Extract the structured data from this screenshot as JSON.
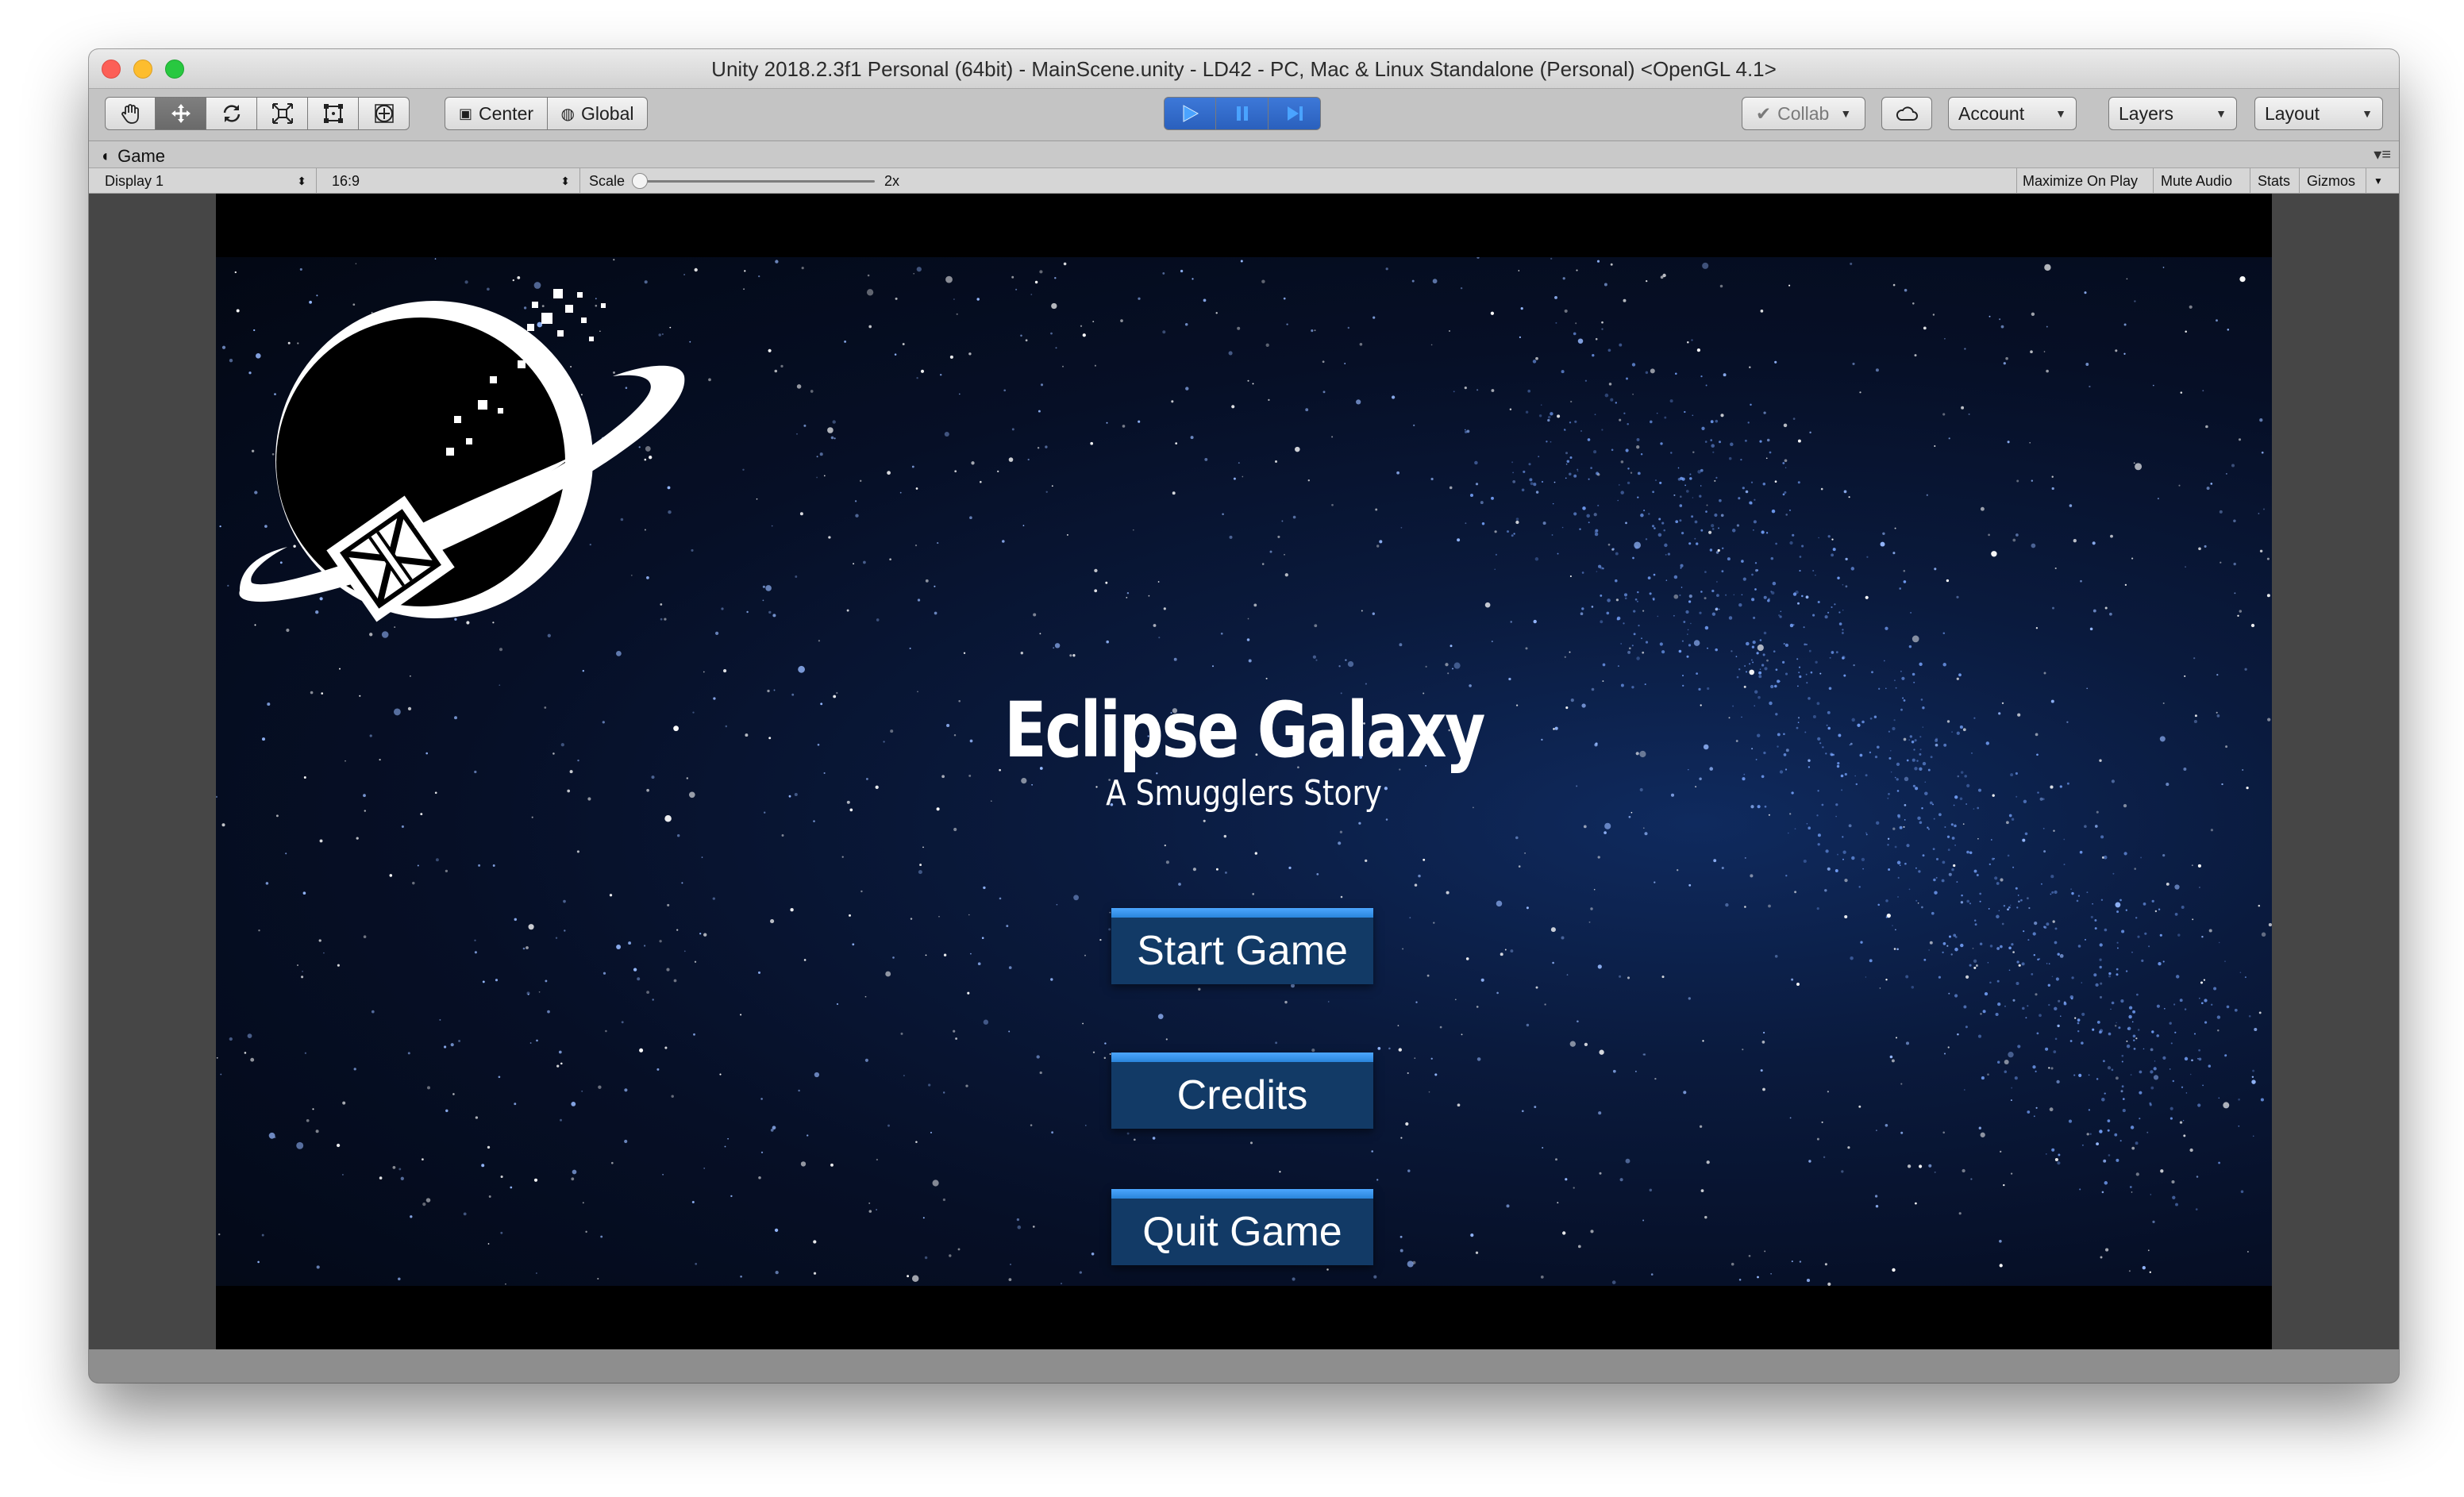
{
  "window": {
    "title": "Unity 2018.2.3f1 Personal (64bit) - MainScene.unity - LD42 - PC, Mac & Linux Standalone (Personal) <OpenGL 4.1>"
  },
  "toolbar": {
    "tools": [
      "hand-icon",
      "move-icon",
      "rotate-icon",
      "scale-icon",
      "rect-icon",
      "transform-icon"
    ],
    "pivot_center": "Center",
    "pivot_global": "Global",
    "collab": "Collab",
    "account": "Account",
    "layers": "Layers",
    "layout": "Layout",
    "play_color": "#2a60bd"
  },
  "game_panel": {
    "tab_label": "Game",
    "display": "Display 1",
    "aspect": "16:9",
    "scale_label": "Scale",
    "scale_value": "2x",
    "maximize_on_play": "Maximize On Play",
    "mute_audio": "Mute Audio",
    "stats": "Stats",
    "gizmos": "Gizmos"
  },
  "game": {
    "title": "Eclipse Galaxy",
    "subtitle": "A Smugglers Story",
    "buttons": {
      "start": "Start Game",
      "credits": "Credits",
      "quit": "Quit Game"
    },
    "button_color": "#123a66",
    "button_top_color": "#2a8ae0"
  }
}
